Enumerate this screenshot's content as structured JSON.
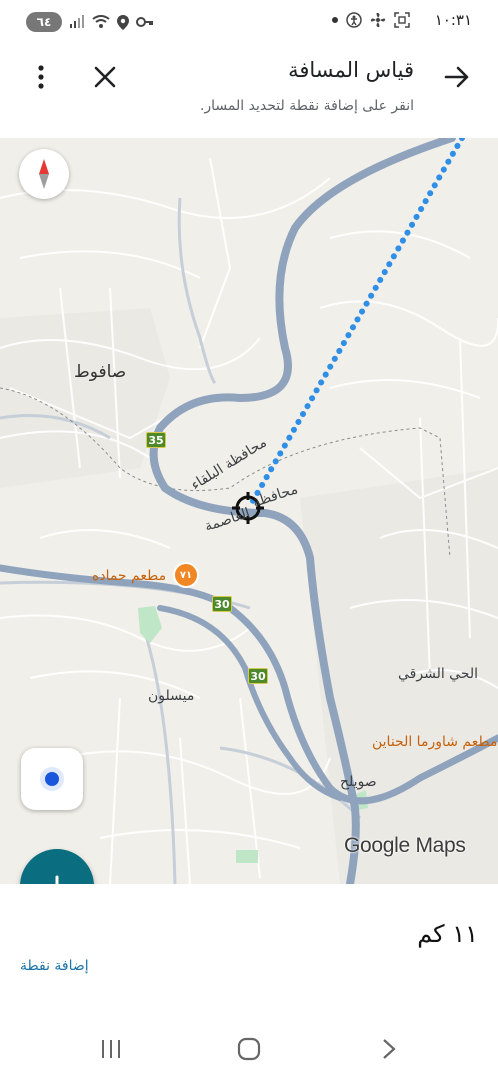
{
  "status_bar": {
    "time": "١٠:٣١",
    "battery": "٦٤",
    "icons": [
      "battery-icon",
      "signal-icon",
      "wifi-icon",
      "location-icon",
      "key-icon",
      "dot-icon",
      "accessibility-icon",
      "fan-icon",
      "screenshot-icon"
    ]
  },
  "header": {
    "title": "قياس المسافة",
    "subtitle": "انقر على إضافة نقطة لتحديد المسار.",
    "back_icon": "arrow-right-icon",
    "close_icon": "close-icon",
    "more_icon": "more-vert-icon"
  },
  "map": {
    "labels": {
      "safout": "صافوط",
      "balqa": "محافظة البلقاء",
      "asima_1": "محافظة",
      "asima_2": "العاصمة",
      "restaurant_hamada": "مطعم حماده",
      "maysaloun": "ميسلون",
      "east_district": "الحي الشرقي",
      "shawarma": "مطعم شاورما الحناين",
      "sweileh": "صويلح"
    },
    "road_shields": [
      "35",
      "30",
      "30"
    ],
    "restaurant_pin": "٧١",
    "logo": "Google Maps",
    "colors": {
      "road": "#8fa3bd",
      "route": "#2f8fe6",
      "park": "#bfe6c7"
    }
  },
  "panel": {
    "distance": "١١ كم",
    "add_point": "إضافة نقطة"
  },
  "navbar": {
    "icons": [
      "recent-apps-icon",
      "home-icon",
      "back-icon"
    ]
  }
}
